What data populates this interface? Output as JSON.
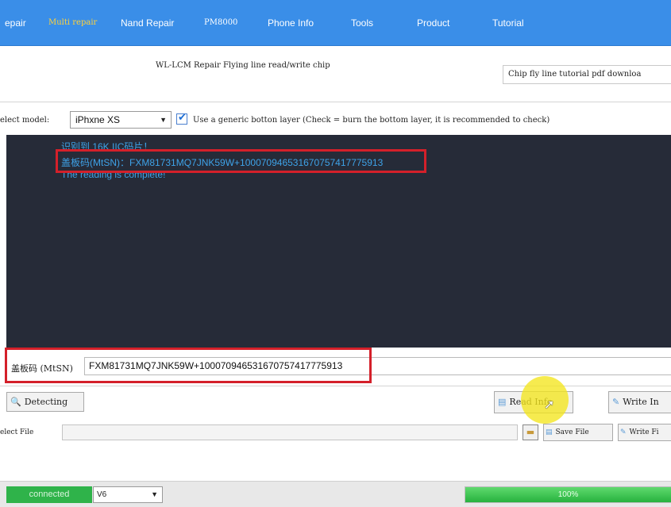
{
  "nav": {
    "tabs": [
      {
        "label": "epair"
      },
      {
        "label": "Multi repair"
      },
      {
        "label": "Nand Repair"
      },
      {
        "label": "PM8000"
      },
      {
        "label": "Phone Info"
      },
      {
        "label": "Tools"
      },
      {
        "label": "Product"
      },
      {
        "label": "Tutorial"
      }
    ],
    "active_tab": "Multi repair"
  },
  "header": {
    "title": "WL-LCM Repair Flying line read/write chip",
    "pdf_button": "Chip fly line tutorial pdf downloa"
  },
  "model": {
    "label": "elect model:",
    "selected": "iPhxne XS",
    "generic_checked": true,
    "generic_label": "Use a generic botton layer (Check = burn the bottom layer, it is recommended to check)"
  },
  "log": {
    "lines": [
      "识别到 16K IIC码片！",
      "盖板码(MtSN)：FXM81731MQ7JNK59W+100070946531670757417775913",
      "The reading is complete!"
    ]
  },
  "mtsn": {
    "label": "盖板码 (MtSN)",
    "value": "FXM81731MQ7JNK59W+100070946531670757417775913"
  },
  "actions": {
    "detecting": "Detecting",
    "read_info": "Read Info",
    "write_info": "Write In"
  },
  "file": {
    "label": "elect File",
    "value": "",
    "save_file": "Save File",
    "write_file": "Write Fi"
  },
  "status": {
    "connection": "connected",
    "version": "V6",
    "progress_percent": 100,
    "progress_text": "100%"
  },
  "colors": {
    "nav_bg": "#3a8ee8",
    "active_tab": "#ffd23a",
    "log_bg": "#262b38",
    "log_text": "#3ea3e8",
    "highlight_red": "#d4202a",
    "connected_green": "#2fb34a"
  }
}
